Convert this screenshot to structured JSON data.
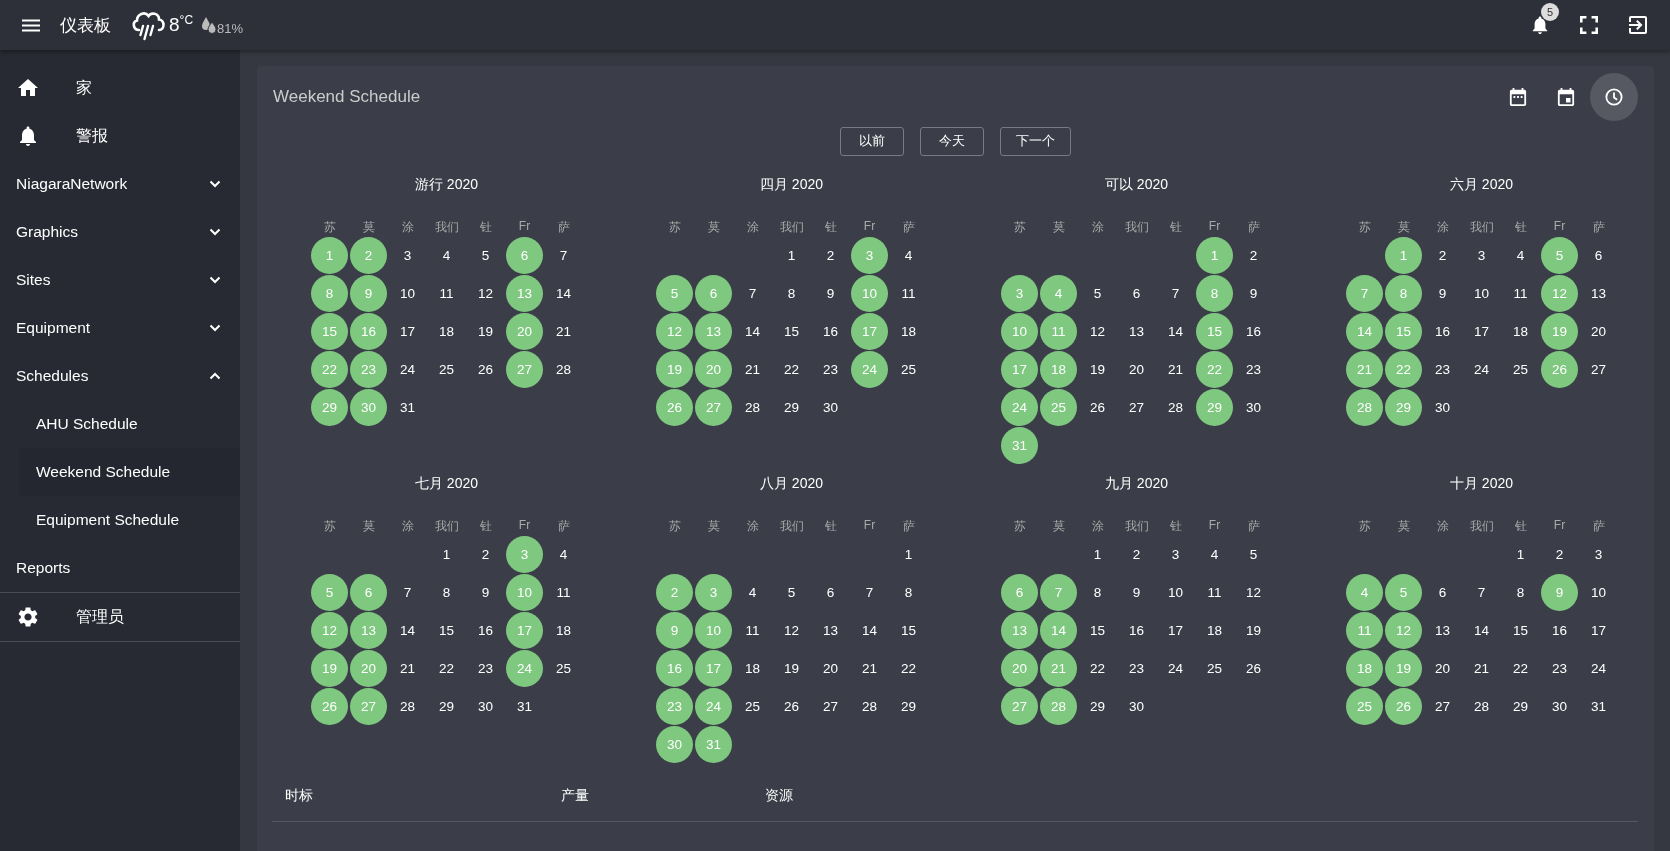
{
  "top_bar": {
    "title": "仪表板",
    "temperature": "8$^{°C}$",
    "humidity": "81%",
    "notification_count": "5"
  },
  "sidebar": {
    "items": [
      {
        "kind": "home",
        "label": "家"
      },
      {
        "kind": "alarm",
        "label": "警报"
      },
      {
        "kind": "group",
        "label": "NiagaraNetwork",
        "expanded": false
      },
      {
        "kind": "group",
        "label": "Graphics",
        "expanded": false
      },
      {
        "kind": "group",
        "label": "Sites",
        "expanded": false
      },
      {
        "kind": "group",
        "label": "Equipment",
        "expanded": false
      },
      {
        "kind": "group",
        "label": "Schedules",
        "expanded": true,
        "children": [
          {
            "label": "AHU Schedule",
            "selected": false
          },
          {
            "label": "Weekend Schedule",
            "selected": true
          },
          {
            "label": "Equipment Schedule",
            "selected": false
          }
        ]
      },
      {
        "kind": "link",
        "label": "Reports"
      },
      {
        "kind": "settings",
        "label": "管理员"
      }
    ]
  },
  "card": {
    "title": "Weekend Schedule",
    "view_buttons": [
      {
        "kind": "month",
        "selected": false
      },
      {
        "kind": "day",
        "selected": false
      },
      {
        "kind": "time",
        "selected": true
      }
    ],
    "nav_buttons": [
      "以前",
      "今天",
      "下一个"
    ],
    "months": [
      {
        "title": "游行 2020",
        "weekdays": [
          "苏",
          "莫",
          "涂",
          "我们",
          "钍",
          "Fr",
          "萨"
        ],
        "weeks": [
          [
            {
              "label": "1",
              "selected": true
            },
            {
              "label": "2",
              "selected": true
            },
            {
              "label": "3",
              "selected": false
            },
            {
              "label": "4",
              "selected": false
            },
            {
              "label": "5",
              "selected": false
            },
            {
              "label": "6",
              "selected": true
            },
            {
              "label": "7",
              "selected": false
            }
          ],
          [
            {
              "label": "8",
              "selected": true
            },
            {
              "label": "9",
              "selected": true
            },
            {
              "label": "10",
              "selected": false
            },
            {
              "label": "11",
              "selected": false
            },
            {
              "label": "12",
              "selected": false
            },
            {
              "label": "13",
              "selected": true
            },
            {
              "label": "14",
              "selected": false
            }
          ],
          [
            {
              "label": "15",
              "selected": true
            },
            {
              "label": "16",
              "selected": true
            },
            {
              "label": "17",
              "selected": false
            },
            {
              "label": "18",
              "selected": false
            },
            {
              "label": "19",
              "selected": false
            },
            {
              "label": "20",
              "selected": true
            },
            {
              "label": "21",
              "selected": false
            }
          ],
          [
            {
              "label": "22",
              "selected": true
            },
            {
              "label": "23",
              "selected": true
            },
            {
              "label": "24",
              "selected": false
            },
            {
              "label": "25",
              "selected": false
            },
            {
              "label": "26",
              "selected": false
            },
            {
              "label": "27",
              "selected": true
            },
            {
              "label": "28",
              "selected": false
            }
          ],
          [
            {
              "label": "29",
              "selected": true
            },
            {
              "label": "30",
              "selected": true
            },
            {
              "label": "31",
              "selected": false
            }
          ]
        ]
      },
      {
        "title": "四月 2020",
        "weekdays": [
          "苏",
          "莫",
          "涂",
          "我们",
          "钍",
          "Fr",
          "萨"
        ],
        "weeks": [
          [
            {
              "label": "1",
              "selected": false
            },
            {
              "label": "2",
              "selected": false
            },
            {
              "label": "3",
              "selected": true
            },
            {
              "label": "4",
              "selected": false
            }
          ],
          [
            {
              "label": "5",
              "selected": true
            },
            {
              "label": "6",
              "selected": true
            },
            {
              "label": "7",
              "selected": false
            },
            {
              "label": "8",
              "selected": false
            },
            {
              "label": "9",
              "selected": false
            },
            {
              "label": "10",
              "selected": true
            },
            {
              "label": "11",
              "selected": false
            }
          ],
          [
            {
              "label": "12",
              "selected": true
            },
            {
              "label": "13",
              "selected": true
            },
            {
              "label": "14",
              "selected": false
            },
            {
              "label": "15",
              "selected": false
            },
            {
              "label": "16",
              "selected": false
            },
            {
              "label": "17",
              "selected": true
            },
            {
              "label": "18",
              "selected": false
            }
          ],
          [
            {
              "label": "19",
              "selected": true
            },
            {
              "label": "20",
              "selected": true
            },
            {
              "label": "21",
              "selected": false
            },
            {
              "label": "22",
              "selected": false
            },
            {
              "label": "23",
              "selected": false
            },
            {
              "label": "24",
              "selected": true
            },
            {
              "label": "25",
              "selected": false
            }
          ],
          [
            {
              "label": "26",
              "selected": true
            },
            {
              "label": "27",
              "selected": true
            },
            {
              "label": "28",
              "selected": false
            },
            {
              "label": "29",
              "selected": false
            },
            {
              "label": "30",
              "selected": false
            }
          ]
        ]
      },
      {
        "title": "可以 2020",
        "weekdays": [
          "苏",
          "莫",
          "涂",
          "我们",
          "钍",
          "Fr",
          "萨"
        ],
        "weeks": [
          [
            {
              "label": "1",
              "selected": true
            },
            {
              "label": "2",
              "selected": false
            }
          ],
          [
            {
              "label": "3",
              "selected": true
            },
            {
              "label": "4",
              "selected": true
            },
            {
              "label": "5",
              "selected": false
            },
            {
              "label": "6",
              "selected": false
            },
            {
              "label": "7",
              "selected": false
            },
            {
              "label": "8",
              "selected": true
            },
            {
              "label": "9",
              "selected": false
            }
          ],
          [
            {
              "label": "10",
              "selected": true
            },
            {
              "label": "11",
              "selected": true
            },
            {
              "label": "12",
              "selected": false
            },
            {
              "label": "13",
              "selected": false
            },
            {
              "label": "14",
              "selected": false
            },
            {
              "label": "15",
              "selected": true
            },
            {
              "label": "16",
              "selected": false
            }
          ],
          [
            {
              "label": "17",
              "selected": true
            },
            {
              "label": "18",
              "selected": true
            },
            {
              "label": "19",
              "selected": false
            },
            {
              "label": "20",
              "selected": false
            },
            {
              "label": "21",
              "selected": false
            },
            {
              "label": "22",
              "selected": true
            },
            {
              "label": "23",
              "selected": false
            }
          ],
          [
            {
              "label": "24",
              "selected": true
            },
            {
              "label": "25",
              "selected": true
            },
            {
              "label": "26",
              "selected": false
            },
            {
              "label": "27",
              "selected": false
            },
            {
              "label": "28",
              "selected": false
            },
            {
              "label": "29",
              "selected": true
            },
            {
              "label": "30",
              "selected": false
            }
          ],
          [
            {
              "label": "31",
              "selected": true
            }
          ]
        ]
      },
      {
        "title": "六月 2020",
        "weekdays": [
          "苏",
          "莫",
          "涂",
          "我们",
          "钍",
          "Fr",
          "萨"
        ],
        "weeks": [
          [
            {
              "label": "1",
              "selected": true
            },
            {
              "label": "2",
              "selected": false
            },
            {
              "label": "3",
              "selected": false
            },
            {
              "label": "4",
              "selected": false
            },
            {
              "label": "5",
              "selected": true
            },
            {
              "label": "6",
              "selected": false
            }
          ],
          [
            {
              "label": "7",
              "selected": true
            },
            {
              "label": "8",
              "selected": true
            },
            {
              "label": "9",
              "selected": false
            },
            {
              "label": "10",
              "selected": false
            },
            {
              "label": "11",
              "selected": false
            },
            {
              "label": "12",
              "selected": true
            },
            {
              "label": "13",
              "selected": false
            }
          ],
          [
            {
              "label": "14",
              "selected": true
            },
            {
              "label": "15",
              "selected": true
            },
            {
              "label": "16",
              "selected": false
            },
            {
              "label": "17",
              "selected": false
            },
            {
              "label": "18",
              "selected": false
            },
            {
              "label": "19",
              "selected": true
            },
            {
              "label": "20",
              "selected": false
            }
          ],
          [
            {
              "label": "21",
              "selected": true
            },
            {
              "label": "22",
              "selected": true
            },
            {
              "label": "23",
              "selected": false
            },
            {
              "label": "24",
              "selected": false
            },
            {
              "label": "25",
              "selected": false
            },
            {
              "label": "26",
              "selected": true
            },
            {
              "label": "27",
              "selected": false
            }
          ],
          [
            {
              "label": "28",
              "selected": true
            },
            {
              "label": "29",
              "selected": true
            },
            {
              "label": "30",
              "selected": false
            }
          ]
        ]
      },
      {
        "title": "七月 2020",
        "weekdays": [
          "苏",
          "莫",
          "涂",
          "我们",
          "钍",
          "Fr",
          "萨"
        ],
        "weeks": [
          [
            {
              "label": "1",
              "selected": false
            },
            {
              "label": "2",
              "selected": false
            },
            {
              "label": "3",
              "selected": true
            },
            {
              "label": "4",
              "selected": false
            }
          ],
          [
            {
              "label": "5",
              "selected": true
            },
            {
              "label": "6",
              "selected": true
            },
            {
              "label": "7",
              "selected": false
            },
            {
              "label": "8",
              "selected": false
            },
            {
              "label": "9",
              "selected": false
            },
            {
              "label": "10",
              "selected": true
            },
            {
              "label": "11",
              "selected": false
            }
          ],
          [
            {
              "label": "12",
              "selected": true
            },
            {
              "label": "13",
              "selected": true
            },
            {
              "label": "14",
              "selected": false
            },
            {
              "label": "15",
              "selected": false
            },
            {
              "label": "16",
              "selected": false
            },
            {
              "label": "17",
              "selected": true
            },
            {
              "label": "18",
              "selected": false
            }
          ],
          [
            {
              "label": "19",
              "selected": true
            },
            {
              "label": "20",
              "selected": true
            },
            {
              "label": "21",
              "selected": false
            },
            {
              "label": "22",
              "selected": false
            },
            {
              "label": "23",
              "selected": false
            },
            {
              "label": "24",
              "selected": true
            },
            {
              "label": "25",
              "selected": false
            }
          ],
          [
            {
              "label": "26",
              "selected": true
            },
            {
              "label": "27",
              "selected": true
            },
            {
              "label": "28",
              "selected": false
            },
            {
              "label": "29",
              "selected": false
            },
            {
              "label": "30",
              "selected": false
            },
            {
              "label": "31",
              "selected": false
            }
          ]
        ]
      },
      {
        "title": "八月 2020",
        "weekdays": [
          "苏",
          "莫",
          "涂",
          "我们",
          "钍",
          "Fr",
          "萨"
        ],
        "weeks": [
          [
            {
              "label": "1",
              "selected": false
            }
          ],
          [
            {
              "label": "2",
              "selected": true
            },
            {
              "label": "3",
              "selected": true
            },
            {
              "label": "4",
              "selected": false
            },
            {
              "label": "5",
              "selected": false
            },
            {
              "label": "6",
              "selected": false
            },
            {
              "label": "7",
              "selected": false
            },
            {
              "label": "8",
              "selected": false
            }
          ],
          [
            {
              "label": "9",
              "selected": true
            },
            {
              "label": "10",
              "selected": true
            },
            {
              "label": "11",
              "selected": false
            },
            {
              "label": "12",
              "selected": false
            },
            {
              "label": "13",
              "selected": false
            },
            {
              "label": "14",
              "selected": false
            },
            {
              "label": "15",
              "selected": false
            }
          ],
          [
            {
              "label": "16",
              "selected": true
            },
            {
              "label": "17",
              "selected": true
            },
            {
              "label": "18",
              "selected": false
            },
            {
              "label": "19",
              "selected": false
            },
            {
              "label": "20",
              "selected": false
            },
            {
              "label": "21",
              "selected": false
            },
            {
              "label": "22",
              "selected": false
            }
          ],
          [
            {
              "label": "23",
              "selected": true
            },
            {
              "label": "24",
              "selected": true
            },
            {
              "label": "25",
              "selected": false
            },
            {
              "label": "26",
              "selected": false
            },
            {
              "label": "27",
              "selected": false
            },
            {
              "label": "28",
              "selected": false
            },
            {
              "label": "29",
              "selected": false
            }
          ],
          [
            {
              "label": "30",
              "selected": true
            },
            {
              "label": "31",
              "selected": true
            }
          ]
        ]
      },
      {
        "title": "九月 2020",
        "weekdays": [
          "苏",
          "莫",
          "涂",
          "我们",
          "钍",
          "Fr",
          "萨"
        ],
        "weeks": [
          [
            {
              "label": "1",
              "selected": false
            },
            {
              "label": "2",
              "selected": false
            },
            {
              "label": "3",
              "selected": false
            },
            {
              "label": "4",
              "selected": false
            },
            {
              "label": "5",
              "selected": false
            }
          ],
          [
            {
              "label": "6",
              "selected": true
            },
            {
              "label": "7",
              "selected": true
            },
            {
              "label": "8",
              "selected": false
            },
            {
              "label": "9",
              "selected": false
            },
            {
              "label": "10",
              "selected": false
            },
            {
              "label": "11",
              "selected": false
            },
            {
              "label": "12",
              "selected": false
            }
          ],
          [
            {
              "label": "13",
              "selected": true
            },
            {
              "label": "14",
              "selected": true
            },
            {
              "label": "15",
              "selected": false
            },
            {
              "label": "16",
              "selected": false
            },
            {
              "label": "17",
              "selected": false
            },
            {
              "label": "18",
              "selected": false
            },
            {
              "label": "19",
              "selected": false
            }
          ],
          [
            {
              "label": "20",
              "selected": true
            },
            {
              "label": "21",
              "selected": true
            },
            {
              "label": "22",
              "selected": false
            },
            {
              "label": "23",
              "selected": false
            },
            {
              "label": "24",
              "selected": false
            },
            {
              "label": "25",
              "selected": false
            },
            {
              "label": "26",
              "selected": false
            }
          ],
          [
            {
              "label": "27",
              "selected": true
            },
            {
              "label": "28",
              "selected": true
            },
            {
              "label": "29",
              "selected": false
            },
            {
              "label": "30",
              "selected": false
            }
          ]
        ]
      },
      {
        "title": "十月 2020",
        "weekdays": [
          "苏",
          "莫",
          "涂",
          "我们",
          "钍",
          "Fr",
          "萨"
        ],
        "weeks": [
          [
            {
              "label": "1",
              "selected": false
            },
            {
              "label": "2",
              "selected": false
            },
            {
              "label": "3",
              "selected": false
            }
          ],
          [
            {
              "label": "4",
              "selected": true
            },
            {
              "label": "5",
              "selected": true
            },
            {
              "label": "6",
              "selected": false
            },
            {
              "label": "7",
              "selected": false
            },
            {
              "label": "8",
              "selected": false
            },
            {
              "label": "9",
              "selected": true
            },
            {
              "label": "10",
              "selected": false
            }
          ],
          [
            {
              "label": "11",
              "selected": true
            },
            {
              "label": "12",
              "selected": true
            },
            {
              "label": "13",
              "selected": false
            },
            {
              "label": "14",
              "selected": false
            },
            {
              "label": "15",
              "selected": false
            },
            {
              "label": "16",
              "selected": false
            },
            {
              "label": "17",
              "selected": false
            }
          ],
          [
            {
              "label": "18",
              "selected": true
            },
            {
              "label": "19",
              "selected": true
            },
            {
              "label": "20",
              "selected": false
            },
            {
              "label": "21",
              "selected": false
            },
            {
              "label": "22",
              "selected": false
            },
            {
              "label": "23",
              "selected": false
            },
            {
              "label": "24",
              "selected": false
            }
          ],
          [
            {
              "label": "25",
              "selected": true
            },
            {
              "label": "26",
              "selected": true
            },
            {
              "label": "27",
              "selected": false
            },
            {
              "label": "28",
              "selected": false
            },
            {
              "label": "29",
              "selected": false
            },
            {
              "label": "30",
              "selected": false
            },
            {
              "label": "31",
              "selected": false
            }
          ]
        ]
      }
    ],
    "table": {
      "columns": [
        "时标",
        "产量",
        "资源"
      ]
    }
  }
}
